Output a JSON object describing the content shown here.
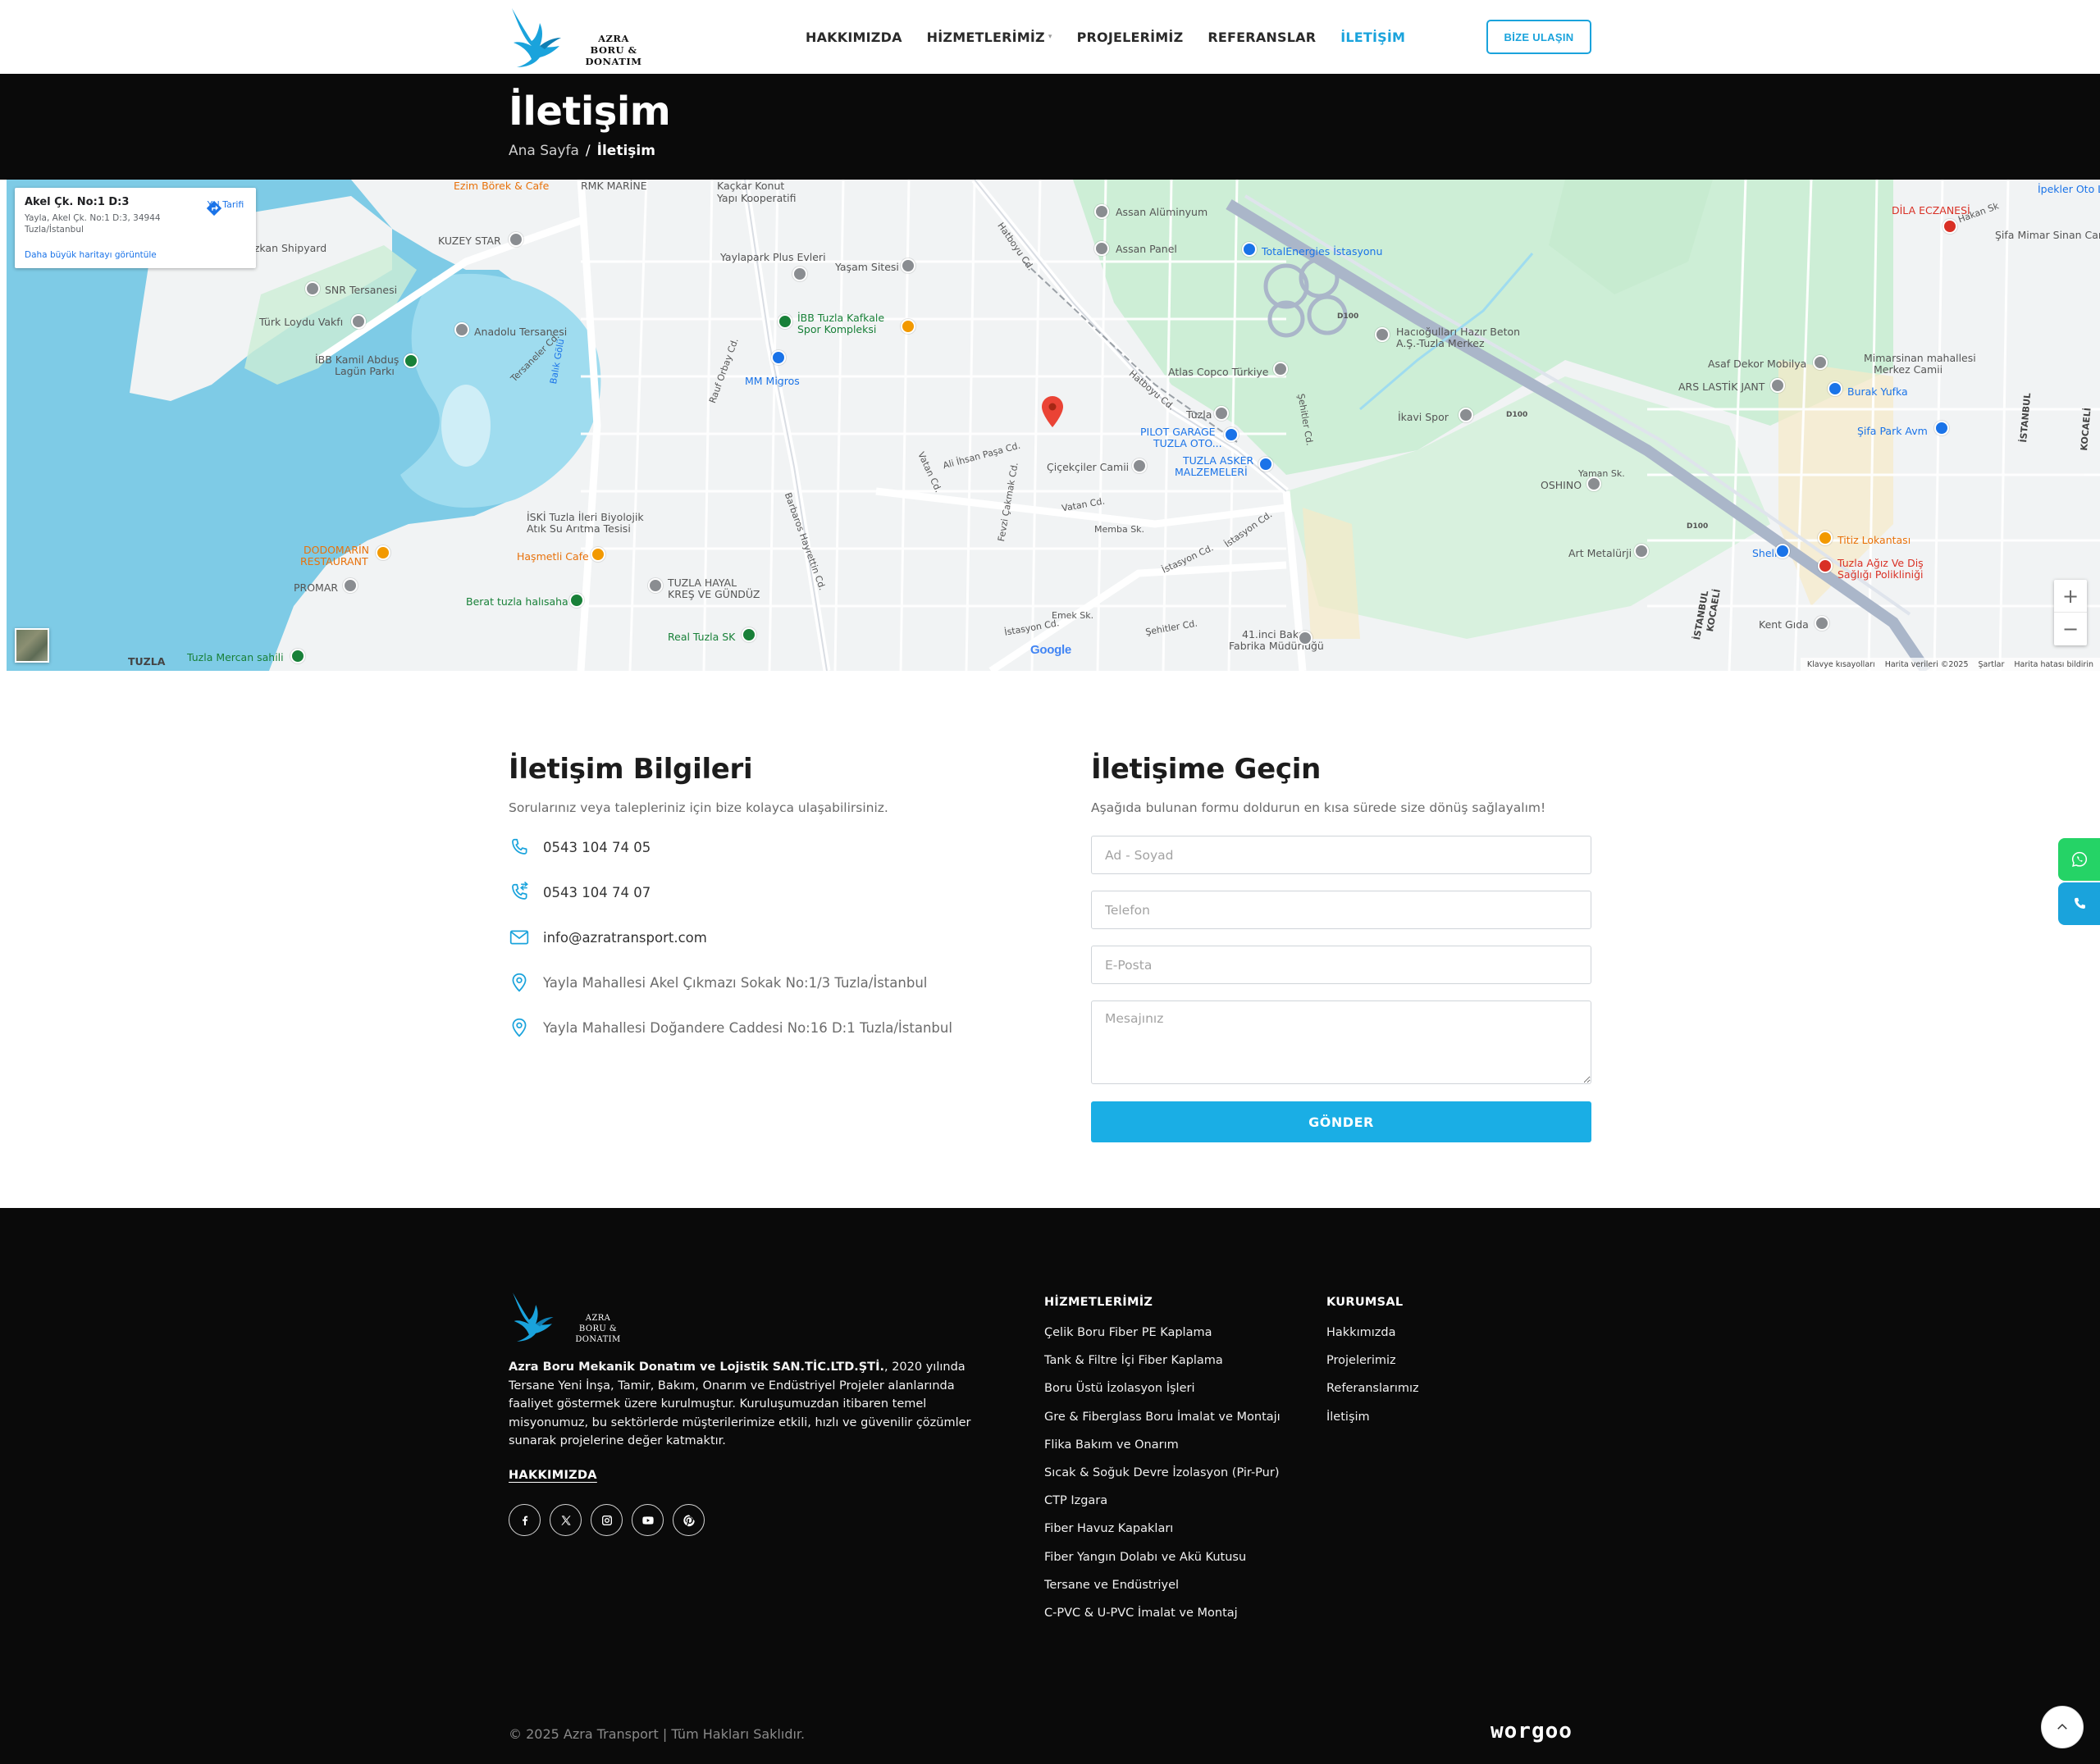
{
  "brand": {
    "line1": "AZRA",
    "line2": "BORU & DONATIM",
    "accent": "#1aa3dc"
  },
  "nav": {
    "items": [
      {
        "label": "HAKKIMIZDA",
        "active": false
      },
      {
        "label": "HİZMETLERİMİZ",
        "active": false,
        "has_dropdown": true
      },
      {
        "label": "PROJELERİMİZ",
        "active": false
      },
      {
        "label": "REFERANSLAR",
        "active": false
      },
      {
        "label": "İLETİŞİM",
        "active": true
      }
    ],
    "cta": "BİZE ULAŞIN"
  },
  "page_header": {
    "title": "İletişim",
    "breadcrumb": {
      "home": "Ana Sayfa",
      "separator": "/",
      "current": "İletişim"
    }
  },
  "map": {
    "card": {
      "title": "Akel Çk. No:1 D:3",
      "address": "Yayla, Akel Çk. No:1 D:3, 34944 Tuzla/İstanbul",
      "larger_map": "Daha büyük haritayı görüntüle",
      "directions": "Yol Tarifi"
    },
    "zoom_in": "+",
    "zoom_out": "−",
    "google": "Google",
    "footer": {
      "shortcuts": "Klavye kısayolları",
      "data": "Harita verileri ©2025",
      "terms": "Şartlar",
      "report": "Harita hatası bildirin"
    },
    "labels": {
      "eczane": "Ezim Börek & Cafe",
      "rmk": "RMK MARİNE",
      "kackar": "Kaçkar Konut",
      "kackar2": "Yapı Kooperatifi",
      "assan_al": "Assan Alüminyum",
      "assan_panel": "Assan Panel",
      "total": "TotalEnergies İstasyonu",
      "dila": "DİLA ECZANESİ",
      "ipekler": "İpekler Oto La",
      "gurkan": "Özkan Shipyard",
      "kuzey": "KUZEY STAR",
      "yaylapark": "Yaylapark Plus Evleri",
      "yasam": "Yaşam Sitesi",
      "snr": "SNR Tersanesi",
      "turk_loydu": "Türk Loydu Vakfı",
      "anadolu": "Anadolu Tersanesi",
      "ibb_tuzla": "İBB Tuzla Kafkale",
      "ibb_tuzla2": "Spor Kompleksi",
      "ibb_kamil": "İBB Kamil Abduş",
      "ibb_kamil2": "Lagün Parkı",
      "mm_migros": "MM Migros",
      "hacioglu": "Hacıoğulları Hazır Beton",
      "hacioglu2": "A.Ş.-Tuzla Merkez",
      "atlas": "Atlas Copco Türkiye",
      "asaf": "Asaf Dekor Mobilya",
      "ars": "ARS LASTİK JANT",
      "burak": "Burak Yufka",
      "mimarsinan": "Mimarsinan mahallesi",
      "mimarsinan2": "Merkez Camii",
      "sifa_park": "Şifa Park Avm",
      "tuzla_istasyon": "Tuzla",
      "pilot": "PILOT GARAGE",
      "pilot2": "TUZLA OTO...",
      "tuzla_asker": "TUZLA ASKER",
      "tuzla_asker2": "MALZEMELERİ",
      "cicekciler": "Çiçekçiler Camii",
      "ikavi": "İkavi Spor",
      "oshino": "OSHINO",
      "balik_golu": "Balık Gölü",
      "iski": "İSKİ Tuzla İleri Biyolojik",
      "iski2": "Atık Su Arıtma Tesisi",
      "dodomarin": "DODOMARİN",
      "dodomarin2": "RESTAURANT",
      "hasmetli": "Haşmetli Cafe",
      "promar": "PROMAR",
      "tuzla_hayal": "TUZLA HAYAL",
      "tuzla_hayal2": "KREŞ VE GÜNDÜZ",
      "berat": "Berat tuzla halısaha",
      "real_tuzla": "Real Tuzla SK",
      "art_metal": "Art Metalürji",
      "shell": "Shell",
      "titiz": "Titiz Lokantası",
      "tuzla_agiz": "Tuzla Ağız Ve Diş",
      "tuzla_agiz2": "Sağlığı Polikliniği",
      "kent_gida": "Kent Gıda",
      "bakim": "41.inci Bakım",
      "bakim2": "Fabrika Müdürlüğü",
      "tuzla_town": "TUZLA",
      "mercan": "Tuzla Mercan sahili",
      "istanbul": "İSTANBUL",
      "kocaeli": "KOCAELİ",
      "istanbul2": "İSTANBUL",
      "kocaeli2": "KOCAELİ",
      "sifa_mimar": "Şifa Mimar Sinan Cami",
      "hakan": "Hakan Sk",
      "yaman": "Yaman Sk.",
      "d100": "D100",
      "d100b": "D100",
      "d100c": "D100",
      "hatboyu": "Hatboyu Cd.",
      "hatboyu2": "Hatboyu Cd.",
      "vatan": "Vatan Cd.",
      "istasyon": "İstasyon Cd.",
      "sehitler": "Şehitler Cd.",
      "fevzi": "Fevzi Çakmak Cd.",
      "barbaros": "Barbaros Hayrettin Cd.",
      "rauf": "Rauf Orbay Cd.",
      "vatan2": "Vatan Cd.",
      "ali_ihsan": "Ali İhsan Paşa Cd.",
      "tersaneler": "Tersaneler Cd.",
      "emek": "Emek Sk.",
      "istasyon2": "İstasyon Cd.",
      "istasyon3": "İstasyon Cd.",
      "memba": "Memba Sk.",
      "sehitler2": "Şehitler Cd."
    }
  },
  "contact_info": {
    "title": "İletişim Bilgileri",
    "subtitle": "Sorularınız veya talepleriniz için bize kolayca ulaşabilirsiniz.",
    "phone1": "0543 104 74 05",
    "phone2": "0543 104 74 07",
    "email": "info@azratransport.com",
    "address1": "Yayla Mahallesi Akel Çıkmazı Sokak No:1/3 Tuzla/İstanbul",
    "address2": "Yayla Mahallesi Doğandere Caddesi No:16 D:1 Tuzla/İstanbul"
  },
  "contact_form": {
    "title": "İletişime Geçin",
    "subtitle": "Aşağıda bulunan formu doldurun en kısa sürede size dönüş sağlayalım!",
    "name_placeholder": "Ad - Soyad",
    "phone_placeholder": "Telefon",
    "email_placeholder": "E-Posta",
    "message_placeholder": "Mesajınız",
    "submit": "GÖNDER"
  },
  "footer": {
    "about_bold": "Azra Boru Mekanik Donatım ve Lojistik SAN.TİC.LTD.ŞTİ.",
    "about_rest": ", 2020 yılında Tersane Yeni İnşa, Tamir, Bakım, Onarım ve Endüstriyel Projeler alanlarında faaliyet göstermek üzere kurulmuştur. Kuruluşumuzdan itibaren temel misyonumuz, bu sektörlerde müşterilerimize etkili, hızlı ve güvenilir çözümler sunarak projelerine değer katmaktır.",
    "more": "HAKKIMIZDA",
    "services_title": "HİZMETLERİMİZ",
    "services": [
      "Çelik Boru Fiber PE Kaplama",
      "Tank & Filtre İçi Fiber Kaplama",
      "Boru Üstü İzolasyon İşleri",
      "Gre & Fiberglass Boru İmalat ve Montajı",
      "Flika Bakım ve Onarım",
      "Sıcak & Soğuk Devre İzolasyon (Pir-Pur)",
      "CTP Izgara",
      "Fiber Havuz Kapakları",
      "Fiber Yangın Dolabı ve Akü Kutusu",
      "Tersane ve Endüstriyel",
      "C-PVC & U-PVC İmalat ve Montaj"
    ],
    "corporate_title": "KURUMSAL",
    "corporate": [
      "Hakkımızda",
      "Projelerimiz",
      "Referanslarımız",
      "İletişim"
    ],
    "copyright": "© 2025 Azra Transport | Tüm Hakları Saklıdır.",
    "credit": "worgoo"
  }
}
